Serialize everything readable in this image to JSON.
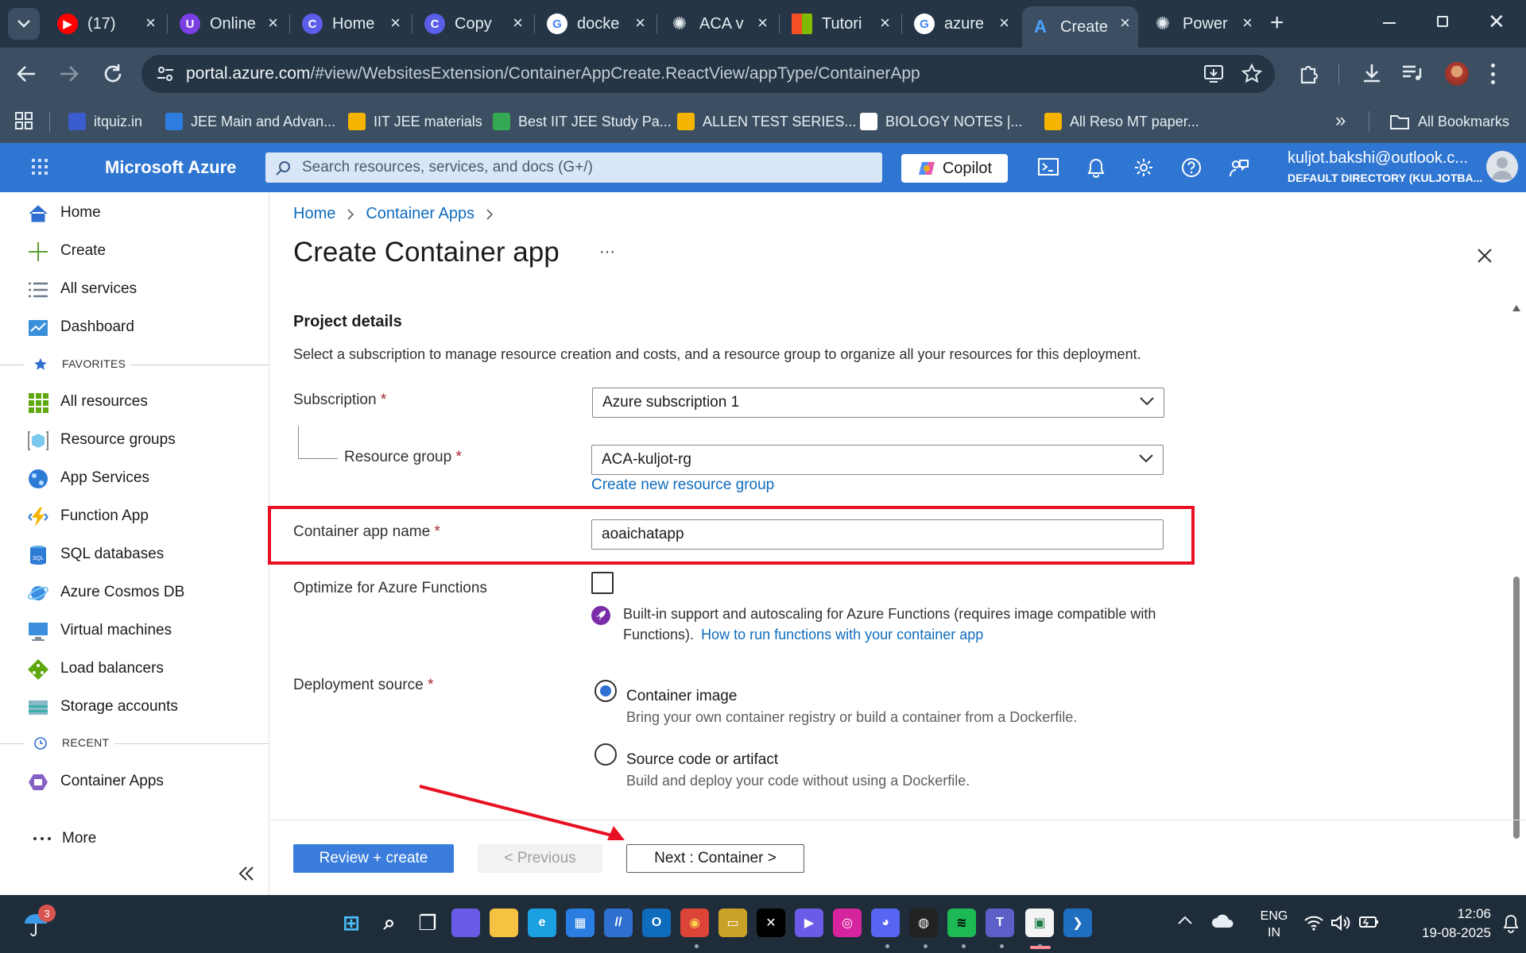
{
  "browser": {
    "tabs": [
      {
        "title": "(17)",
        "icon": "youtube-icon",
        "color": "#ff0000",
        "glyph": "▶"
      },
      {
        "title": "Online",
        "icon": "online-icon",
        "color": "#7b3fe4",
        "glyph": "U"
      },
      {
        "title": "Home",
        "icon": "c-app-icon",
        "color": "#5a5ee8",
        "glyph": "C"
      },
      {
        "title": "Copy",
        "icon": "c-app-icon",
        "color": "#5a5ee8",
        "glyph": "C"
      },
      {
        "title": "docke",
        "icon": "google-icon",
        "color": "#ffffff",
        "glyph": "G"
      },
      {
        "title": "ACA v",
        "icon": "openai-icon",
        "color": "#253545",
        "glyph": "✺"
      },
      {
        "title": "Tutori",
        "icon": "microsoft-icon",
        "color": "#f25022",
        "glyph": ""
      },
      {
        "title": "azure",
        "icon": "google-icon",
        "color": "#ffffff",
        "glyph": "G"
      },
      {
        "title": "Create",
        "icon": "azure-icon",
        "color": "#0f6cbd",
        "glyph": "A"
      },
      {
        "title": "Power",
        "icon": "openai-icon",
        "color": "#253545",
        "glyph": "✺"
      }
    ],
    "url_host": "portal.azure.com",
    "url_path": "/#view/WebsitesExtension/ContainerAppCreate.ReactView/appType/ContainerApp",
    "bookmarks": [
      {
        "label": "itquiz.in",
        "color": "#3b5ccc"
      },
      {
        "label": "JEE Main and Advan...",
        "color": "#2e7de1"
      },
      {
        "label": "IIT JEE materials",
        "color": "#f4b400"
      },
      {
        "label": "Best IIT JEE Study Pa...",
        "color": "#34a853"
      },
      {
        "label": "ALLEN TEST SERIES...",
        "color": "#f4b400"
      },
      {
        "label": "BIOLOGY NOTES |...",
        "color": "#ffffff"
      },
      {
        "label": "All Reso MT paper...",
        "color": "#f4b400"
      }
    ],
    "all_bookmarks": "All Bookmarks"
  },
  "azure": {
    "brand": "Microsoft Azure",
    "search_placeholder": "Search resources, services, and docs (G+/)",
    "copilot": "Copilot",
    "user_email": "kuljot.bakshi@outlook.c...",
    "user_directory": "DEFAULT DIRECTORY (KULJOTBA..."
  },
  "sidebar": {
    "items_top": [
      {
        "label": "Home",
        "icon": "home-icon"
      },
      {
        "label": "Create",
        "icon": "plus-icon"
      },
      {
        "label": "All services",
        "icon": "list-icon"
      },
      {
        "label": "Dashboard",
        "icon": "dashboard-icon"
      }
    ],
    "favorites_heading": "FAVORITES",
    "favorites": [
      {
        "label": "All resources",
        "icon": "all-resources-icon"
      },
      {
        "label": "Resource groups",
        "icon": "resource-groups-icon"
      },
      {
        "label": "App Services",
        "icon": "app-services-icon"
      },
      {
        "label": "Function App",
        "icon": "function-app-icon"
      },
      {
        "label": "SQL databases",
        "icon": "sql-databases-icon"
      },
      {
        "label": "Azure Cosmos DB",
        "icon": "cosmos-db-icon"
      },
      {
        "label": "Virtual machines",
        "icon": "virtual-machines-icon"
      },
      {
        "label": "Load balancers",
        "icon": "load-balancers-icon"
      },
      {
        "label": "Storage accounts",
        "icon": "storage-accounts-icon"
      }
    ],
    "recent_heading": "RECENT",
    "recent": [
      {
        "label": "Container Apps",
        "icon": "container-apps-icon"
      }
    ],
    "more": "More"
  },
  "page": {
    "breadcrumb": [
      "Home",
      "Container Apps"
    ],
    "title": "Create Container app",
    "ellipsis": "···",
    "section_title": "Project details",
    "section_desc": "Select a subscription to manage resource creation and costs, and a resource group to organize all your resources for this deployment.",
    "subscription_label": "Subscription",
    "subscription_value": "Azure subscription 1",
    "resource_group_label": "Resource group",
    "resource_group_value": "ACA-kuljot-rg",
    "create_rg_link": "Create new resource group",
    "app_name_label": "Container app name",
    "app_name_value": "aoaichatapp",
    "optimize_label": "Optimize for Azure Functions",
    "optimize_checked": false,
    "functions_info": "Built-in support and autoscaling for Azure Functions (requires image compatible with",
    "functions_info2": "Functions).",
    "functions_link": "How to run functions with your container app",
    "deploy_label": "Deployment source",
    "deploy_options": [
      {
        "title": "Container image",
        "desc": "Bring your own container registry or build a container from a Dockerfile.",
        "selected": true
      },
      {
        "title": "Source code or artifact",
        "desc": "Build and deploy your code without using a Dockerfile.",
        "selected": false
      }
    ],
    "required_mark": "*",
    "buttons": {
      "review": "Review + create",
      "previous": "< Previous",
      "next": "Next : Container >"
    }
  },
  "taskbar": {
    "weather_badge": "3",
    "lang_top": "ENG",
    "lang_bottom": "IN",
    "time": "12:06",
    "date": "19-08-2025"
  },
  "colors": {
    "azure_blue": "#2f76d2",
    "link": "#0f6cbd",
    "highlight_red": "#e81123",
    "primary_button": "#3b7ddd"
  }
}
